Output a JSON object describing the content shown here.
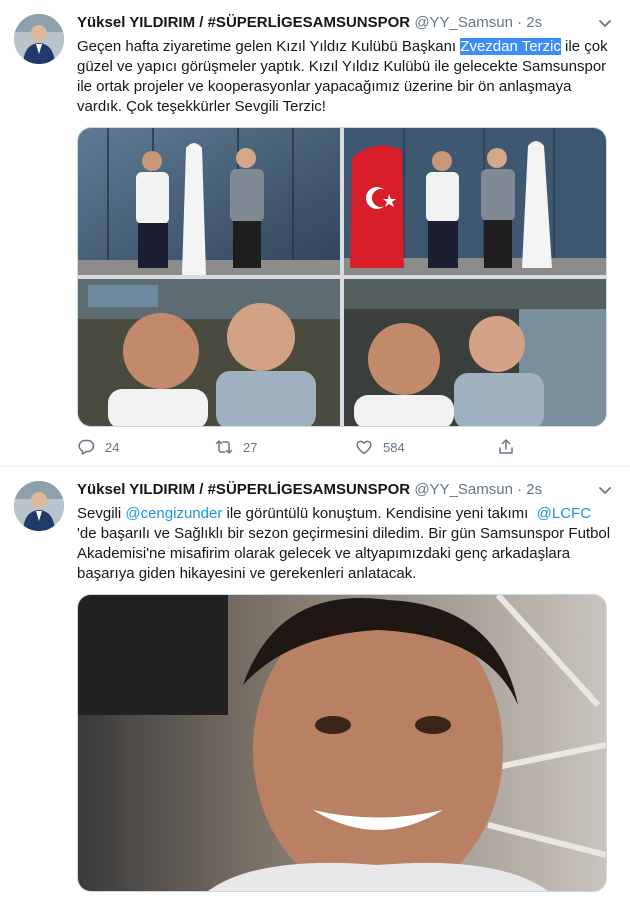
{
  "tweets": [
    {
      "display_name": "Yüksel YILDIRIM / #SÜPERLİGESAMSUNSPOR",
      "handle": "@YY_Samsun",
      "dot": "·",
      "time": "2s",
      "text_part1": "Geçen hafta ziyaretime gelen Kızıl Yıldız Kulübü Başkanı ",
      "text_highlight": "Zvezdan Terzic",
      "text_part2": " ile çok güzel ve yapıcı görüşmeler yaptık. Kızıl Yıldız Kulübü ile gelecekte Samsunspor ile ortak projeler ve kooperasyonlar yapacağımız üzerine bir ön anlaşmaya vardık. Çok teşekkürler Sevgili Terzic!",
      "actions": {
        "reply_count": "24",
        "retweet_count": "27",
        "like_count": "584"
      }
    },
    {
      "display_name": "Yüksel YILDIRIM / #SÜPERLİGESAMSUNSPOR",
      "handle": "@YY_Samsun",
      "dot": "·",
      "time": "2s",
      "text_part1": "Sevgili ",
      "mention1": "@cengizunder",
      "text_part2": " ile görüntülü konuştum. Kendisine yeni takımı  ",
      "mention2": "@LCFC",
      "text_part3": " 'de başarılı ve Sağlıklı bir sezon geçirmesini diledim. Bir gün Samsunspor Futbol Akademisi'ne misafirim olarak gelecek ve altyapımızdaki genç arkadaşlara başarıya giden hikayesini ve gerekenleri anlatacak."
    }
  ],
  "colors": {
    "link": "#1b95e0",
    "secondary_text": "#657786",
    "highlight": "#3e8ef7"
  },
  "icons": [
    "chevron-down-icon",
    "reply-icon",
    "retweet-icon",
    "like-icon",
    "share-icon"
  ]
}
